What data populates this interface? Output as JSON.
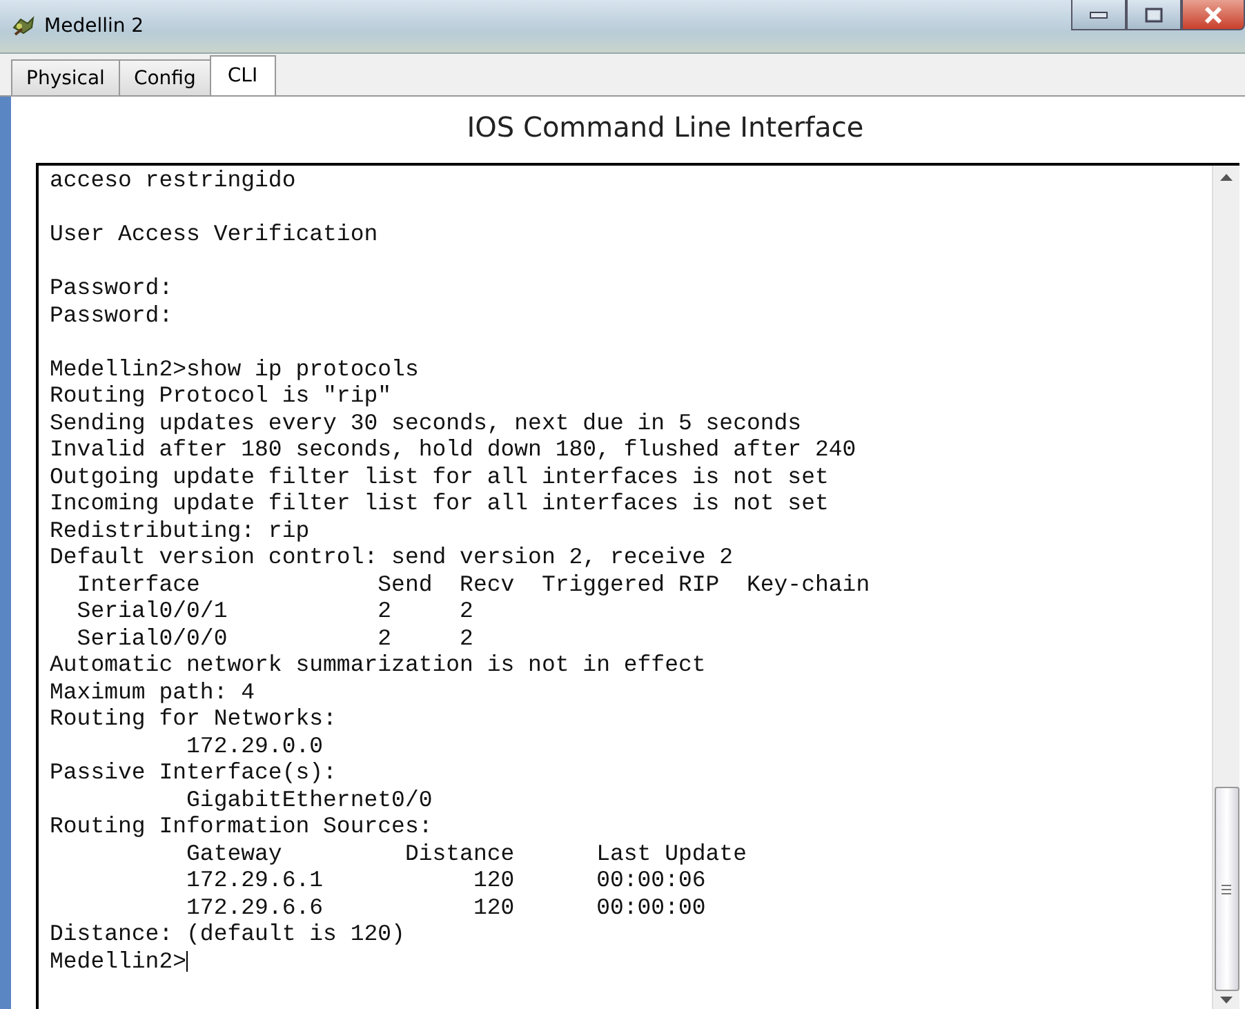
{
  "window": {
    "title": "Medellin 2"
  },
  "tabs": [
    {
      "label": "Physical",
      "selected": false
    },
    {
      "label": "Config",
      "selected": false
    },
    {
      "label": "CLI",
      "selected": true
    }
  ],
  "heading": "IOS Command Line Interface",
  "console": {
    "blocks": [
      [
        "acceso restringido"
      ],
      [
        "User Access Verification"
      ],
      [
        "Password:",
        "Password:"
      ],
      [
        "Medellin2>show ip protocols",
        "Routing Protocol is \"rip\"",
        "Sending updates every 30 seconds, next due in 5 seconds",
        "Invalid after 180 seconds, hold down 180, flushed after 240",
        "Outgoing update filter list for all interfaces is not set",
        "Incoming update filter list for all interfaces is not set",
        "Redistributing: rip",
        "Default version control: send version 2, receive 2",
        "  Interface             Send  Recv  Triggered RIP  Key-chain",
        "  Serial0/0/1           2     2",
        "  Serial0/0/0           2     2",
        "Automatic network summarization is not in effect",
        "Maximum path: 4",
        "Routing for Networks:",
        "          172.29.0.0",
        "Passive Interface(s):",
        "          GigabitEthernet0/0",
        "Routing Information Sources:",
        "          Gateway         Distance      Last Update",
        "          172.29.6.1           120      00:00:06",
        "          172.29.6.6           120      00:00:00",
        "Distance: (default is 120)",
        "Medellin2>"
      ]
    ]
  }
}
